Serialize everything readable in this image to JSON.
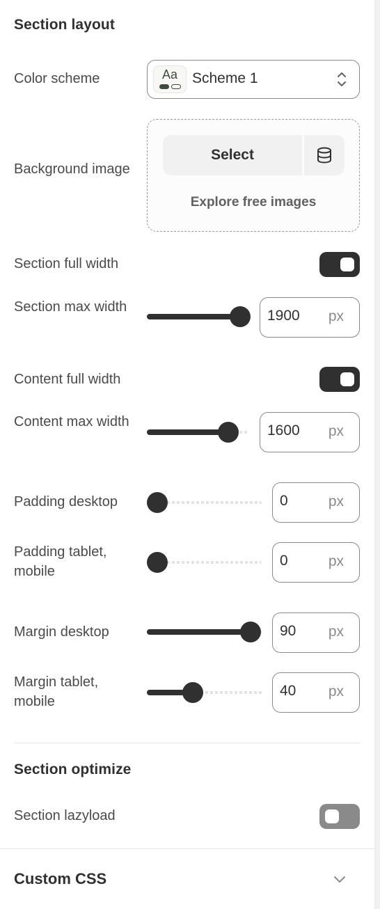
{
  "section_layout": {
    "heading": "Section layout",
    "color_scheme": {
      "label": "Color scheme",
      "value": "Scheme 1",
      "swatch_text": "Aa",
      "swatch_color": "#3c4a3c"
    },
    "background_image": {
      "label": "Background image",
      "select_label": "Select",
      "explore_label": "Explore free images"
    },
    "section_full_width": {
      "label": "Section full width",
      "enabled": true
    },
    "section_max_width": {
      "label": "Section max width",
      "value": "1900",
      "unit": "px",
      "fraction": 1.0
    },
    "content_full_width": {
      "label": "Content full width",
      "enabled": true
    },
    "content_max_width": {
      "label": "Content max width",
      "value": "1600",
      "unit": "px",
      "fraction": 0.8
    },
    "padding_desktop": {
      "label": "Padding desktop",
      "value": "0",
      "unit": "px",
      "fraction": 0.0
    },
    "padding_mobile": {
      "label": "Padding tablet, mobile",
      "value": "0",
      "unit": "px",
      "fraction": 0.0
    },
    "margin_desktop": {
      "label": "Margin desktop",
      "value": "90",
      "unit": "px",
      "fraction": 0.9
    },
    "margin_mobile": {
      "label": "Margin tablet, mobile",
      "value": "40",
      "unit": "px",
      "fraction": 0.4
    }
  },
  "section_optimize": {
    "heading": "Section optimize",
    "lazyload": {
      "label": "Section lazyload",
      "enabled": false
    }
  },
  "custom_css": {
    "title": "Custom CSS"
  },
  "colors": {
    "accent": "#303030",
    "toggle_off": "#8a8a8a"
  }
}
